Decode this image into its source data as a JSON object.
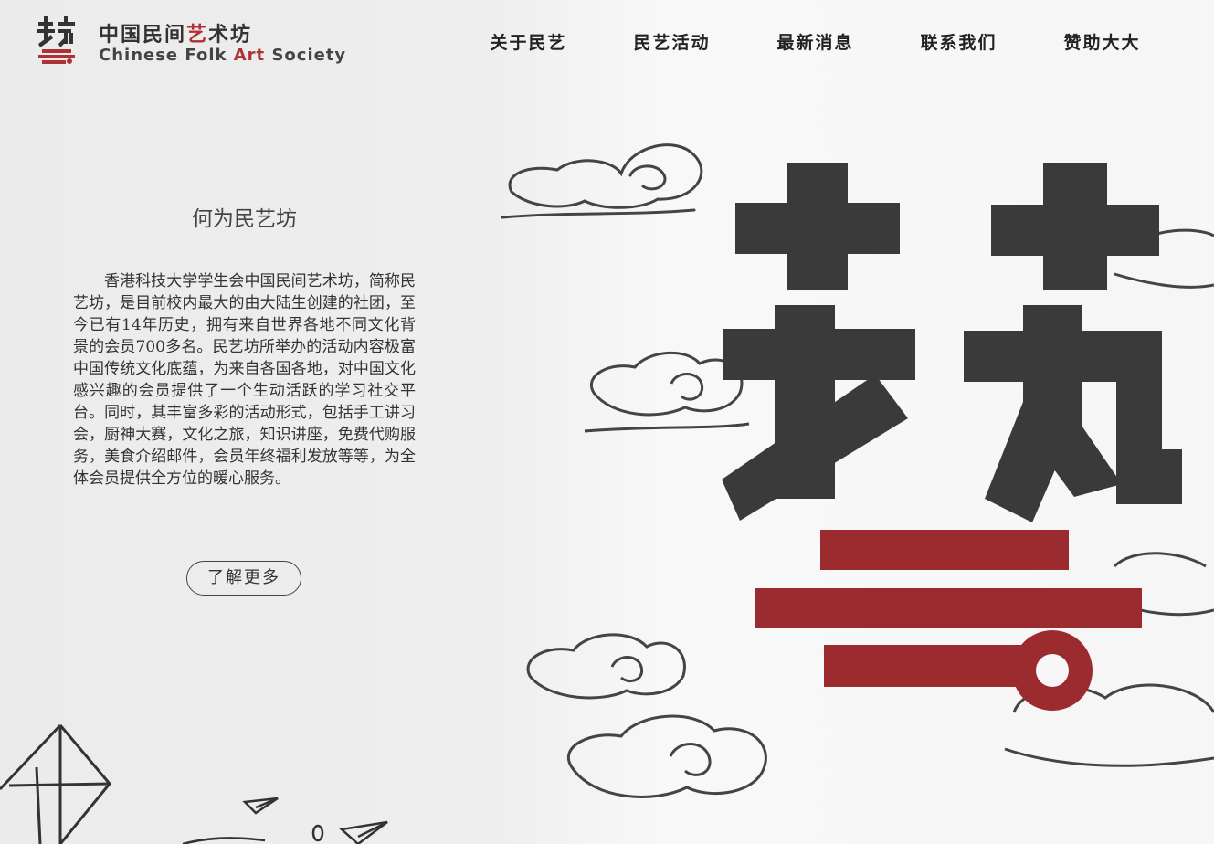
{
  "brand": {
    "name_cn_prefix": "中国民间",
    "name_cn_accent": "艺",
    "name_cn_suffix": "术坊",
    "name_en_prefix": "Chinese Folk ",
    "name_en_accent": "Art",
    "name_en_suffix": " Society",
    "logo_icon": "yi-character-icon",
    "accent_color": "#b03033"
  },
  "nav": {
    "items": [
      {
        "label": "关于民艺"
      },
      {
        "label": "民艺活动"
      },
      {
        "label": "最新消息"
      },
      {
        "label": "联系我们"
      },
      {
        "label": "赞助大大"
      }
    ]
  },
  "intro": {
    "title": "何为民艺坊",
    "body": "香港科技大学学生会中国民间艺术坊，简称民艺坊，是目前校内最大的由大陆生创建的社团，至今已有14年历史，拥有来自世界各地不同文化背景的会员700多名。民艺坊所举办的活动内容极富中国传统文化底蕴，为来自各国各地，对中国文化感兴趣的会员提供了一个生动活跃的学习社交平台。同时，其丰富多彩的活动形式，包括手工讲习会，厨神大赛，文化之旅，知识讲座，免费代购服务，美食介绍邮件，会员年终福利发放等等，为全体会员提供全方位的暖心服务。",
    "more_label": "了解更多"
  },
  "hero": {
    "icon": "yi-calligraphy-icon",
    "cloud_icon": "cloud-icon",
    "ink_color": "#3a3a3a",
    "red_color": "#9b2b2e"
  },
  "decor": {
    "kite_icon": "kite-icon",
    "plane_icon": "paper-plane-icon"
  }
}
